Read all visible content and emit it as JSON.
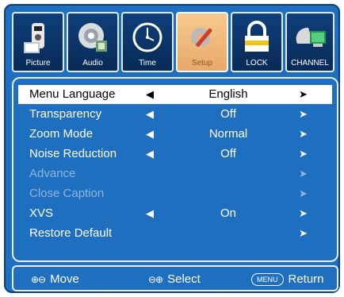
{
  "tabs": [
    {
      "label": "Picture",
      "icon": "tv-remote-icon"
    },
    {
      "label": "Audio",
      "icon": "speaker-icon"
    },
    {
      "label": "Time",
      "icon": "clock-icon"
    },
    {
      "label": "Setup",
      "icon": "tools-icon"
    },
    {
      "label": "LOCK",
      "icon": "lock-icon"
    },
    {
      "label": "CHANNEL",
      "icon": "satellite-monitor-icon"
    }
  ],
  "menu": {
    "items": [
      {
        "label": "Menu Language",
        "left": "◀",
        "value": "English",
        "right": "➤",
        "state": "selected"
      },
      {
        "label": "Transparency",
        "left": "◀",
        "value": "Off",
        "right": "➤",
        "state": "normal"
      },
      {
        "label": "Zoom Mode",
        "left": "◀",
        "value": "Normal",
        "right": "➤",
        "state": "normal"
      },
      {
        "label": "Noise Reduction",
        "left": "◀",
        "value": "Off",
        "right": "➤",
        "state": "normal"
      },
      {
        "label": "Advance",
        "left": "",
        "value": "",
        "right": "➤",
        "state": "disabled"
      },
      {
        "label": "Close Caption",
        "left": "",
        "value": "",
        "right": "➤",
        "state": "disabled"
      },
      {
        "label": "XVS",
        "left": "◀",
        "value": "On",
        "right": "➤",
        "state": "normal"
      },
      {
        "label": "Restore Default",
        "left": "",
        "value": "",
        "right": "➤",
        "state": "normal"
      }
    ]
  },
  "footer": {
    "move_label": "Move",
    "move_icon": "up-down-arrows-icon",
    "select_label": "Select",
    "select_icon": "left-right-arrows-icon",
    "menu_key": "MENU",
    "return_label": "Return"
  },
  "colors": {
    "background": "#1f6fc0",
    "active_tab": "#e9a86a",
    "selected_row": "#ffffff",
    "disabled_text": "#8fb6de"
  }
}
